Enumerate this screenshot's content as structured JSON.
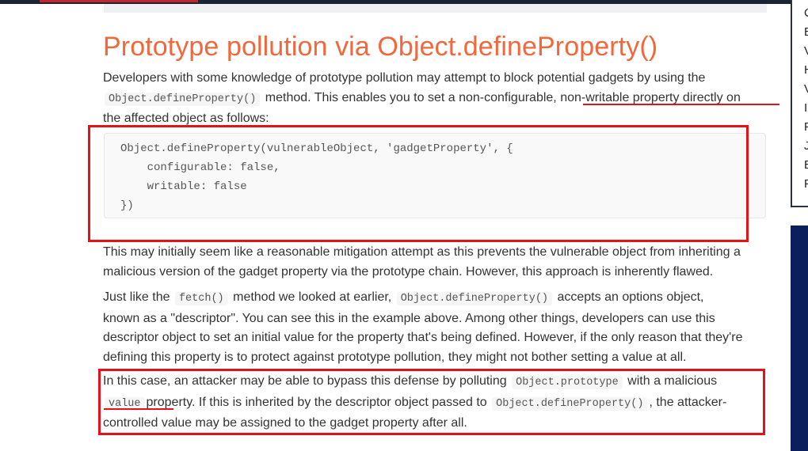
{
  "article": {
    "title": "Prototype pollution via Object.defineProperty()",
    "p1": {
      "t1": "Developers with some knowledge of prototype pollution may attempt to block potential gadgets by using the",
      "code1": "Object.defineProperty()",
      "t2": "method. This enables you to set a non-configurable,",
      "t3": "non-writable property directly on",
      "t4": "the affected object as follows:"
    },
    "code_block": "Object.defineProperty(vulnerableObject, 'gadgetProperty', {\n    configurable: false,\n    writable: false\n})",
    "p2": {
      "line1": "This may initially seem like a reasonable mitigation attempt as this prevents the vulnerable object from inheriting a",
      "line2": "malicious version of the gadget property via the prototype chain. However, this approach is inherently flawed."
    },
    "p3": {
      "t1": "Just like the",
      "code1": "fetch()",
      "t2": "method we looked at earlier,",
      "code2": "Object.defineProperty()",
      "t3": "accepts an options object,",
      "line2": "known as a \"descriptor\". You can see this in the example above. Among other things, developers can use this",
      "line3": "descriptor object to set an initial value for the property that's being defined. However, if the only reason that they're",
      "line4": "defining this property is to protect against prototype pollution, they might not bother setting a value at all."
    },
    "p4": {
      "t1": "In this case, an attacker may be able to bypass this defense by polluting",
      "code1": "Object.prototype",
      "t2": "with a malicious",
      "code2": "value",
      "t3": "property. If this is inherited by the descriptor object passed to",
      "code3": "Object.defineProperty()",
      "t4": ", the attacker-",
      "line3": "controlled value may be assigned to the gadget property after all."
    }
  },
  "side_panel": {
    "letters": [
      "C",
      "E",
      "V",
      "H",
      "V",
      "I",
      "F",
      "J",
      "E",
      "F"
    ]
  },
  "colors": {
    "title": "#f0683c",
    "annotation_red": "#e3121b",
    "dark_block": "#0a1f5c"
  }
}
